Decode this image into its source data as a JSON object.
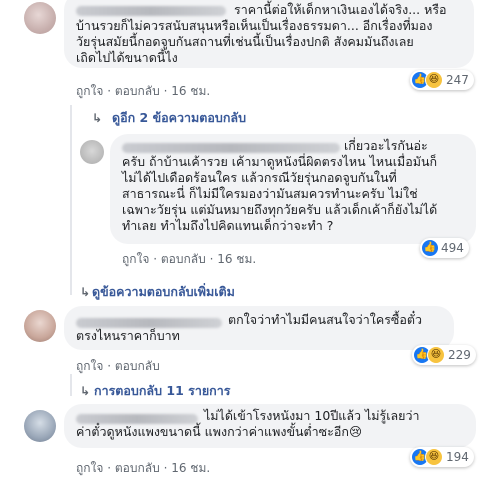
{
  "comments": [
    {
      "lines": [
        "ราคานี้ต่อให้เด็กหาเงินเองได้จริง... หรือ",
        "บ้านรวยก็ไม่ควรสนับสนุนหรือเห็นเป็นเรื่องธรรมดา... อีกเรื่องที่มอง",
        "วัยรุ่นสมัยนี้กอดจูบกันสถานที่เช่นนี้เป็นเรื่องปกติ สังคมมันถึงเลย",
        "เถิดไปได้ขนาดนี้ไง"
      ],
      "like": "ถูกใจ",
      "reply": "ตอบกลับ",
      "time": "16 ชม.",
      "reaction_count": "247",
      "reactions": [
        "like-icon",
        "haha-icon"
      ]
    },
    {
      "lines": [
        "เกี่ยวอะไรกันอ่ะ",
        "ครับ ถ้าบ้านเค้ารวย เค้ามาดูหนังนี่ผิดตรงไหน ไหนเมื่อมันก็",
        "ไม่ได้ไปเดือดร้อนใคร แล้วกรณีวัยรุ่นกอดจูบกันในที่",
        "สาธารณะนี่ ก็ไม่มีใครมองว่ามันสมควรทำนะครับ ไม่ใช่",
        "เฉพาะวัยรุ่น แต่มันหมายถึงทุกวัยครับ แล้วเด็กเค้าก็ยังไม่ได้",
        "ทำเลย ทำไมถึงไปคิดแทนเด็กว่าจะทำ ?"
      ],
      "like": "ถูกใจ",
      "reply": "ตอบกลับ",
      "time": "16 ชม.",
      "reaction_count": "494",
      "reactions": [
        "like-icon"
      ]
    },
    {
      "lines": [
        "ตกใจว่าทำไมมีคนสนใจว่าใครซื้อตั๋ว",
        "ตรงไหนราคาก็บาท"
      ],
      "like": "ถูกใจ",
      "reply": "ตอบกลับ",
      "time": "16 ชม.",
      "reaction_count": "229",
      "reactions": [
        "like-icon",
        "haha-icon"
      ]
    },
    {
      "lines": [
        "ไม่ได้เข้าโรงหนังมา 10ปีแล้ว ไม่รู้เลยว่า",
        "ค่าตั๋วดูหนังแพงขนาดนี้ แพงกว่าค่าแพงขั้นต่ำซะอีก😢"
      ],
      "like": "ถูกใจ",
      "reply": "ตอบกลับ",
      "time": "16 ชม.",
      "reaction_count": "194",
      "reactions": [
        "like-icon",
        "haha-icon"
      ]
    }
  ],
  "reply_links": {
    "view_two": "ดูอีก 2 ข้อความตอบกลับ",
    "view_more": "ดูข้อความตอบกลับเพิ่มเติม",
    "eleven": "การตอบกลับ 11 รายการ"
  },
  "icons": {
    "reply_arrow": "reply-arrow-icon"
  },
  "colors": {
    "link": "#385898",
    "meta": "#606770",
    "bubble": "#f2f3f5",
    "like": "#1877f2",
    "haha": "#f7c33f"
  }
}
